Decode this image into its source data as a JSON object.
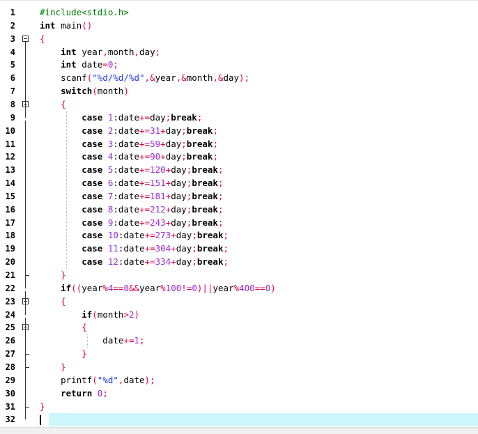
{
  "editor": {
    "lines": [
      {
        "num": "1",
        "code": "#include<stdio.h>"
      },
      {
        "num": "2",
        "code": "int main()"
      },
      {
        "num": "3",
        "code": "{"
      },
      {
        "num": "4",
        "code": "    int year,month,day;"
      },
      {
        "num": "5",
        "code": "    int date=0;"
      },
      {
        "num": "6",
        "code": "    scanf(\"%d/%d/%d\",&year,&month,&day);"
      },
      {
        "num": "7",
        "code": "    switch(month)"
      },
      {
        "num": "8",
        "code": "    {"
      },
      {
        "num": "9",
        "code": "        case 1:date+=day;break;"
      },
      {
        "num": "10",
        "code": "        case 2:date+=31+day;break;"
      },
      {
        "num": "11",
        "code": "        case 3:date+=59+day;break;"
      },
      {
        "num": "12",
        "code": "        case 4:date+=90+day;break;"
      },
      {
        "num": "13",
        "code": "        case 5:date+=120+day;break;"
      },
      {
        "num": "14",
        "code": "        case 6:date+=151+day;break;"
      },
      {
        "num": "15",
        "code": "        case 7:date+=181+day;break;"
      },
      {
        "num": "16",
        "code": "        case 8:date+=212+day;break;"
      },
      {
        "num": "17",
        "code": "        case 9:date+=243+day;break;"
      },
      {
        "num": "18",
        "code": "        case 10:date+=273+day;break;"
      },
      {
        "num": "19",
        "code": "        case 11:date+=304+day;break;"
      },
      {
        "num": "20",
        "code": "        case 12:date+=334+day;break;"
      },
      {
        "num": "21",
        "code": "    }"
      },
      {
        "num": "22",
        "code": "    if((year%4==0&&year%100!=0)||year%400==0)"
      },
      {
        "num": "23",
        "code": "    {"
      },
      {
        "num": "24",
        "code": "        if(month>2)"
      },
      {
        "num": "25",
        "code": "        {"
      },
      {
        "num": "26",
        "code": "            date+=1;"
      },
      {
        "num": "27",
        "code": "        }"
      },
      {
        "num": "28",
        "code": "    }"
      },
      {
        "num": "29",
        "code": "    printf(\"%d\",date);"
      },
      {
        "num": "30",
        "code": "    return 0;"
      },
      {
        "num": "31",
        "code": "}"
      },
      {
        "num": "32",
        "code": ""
      }
    ],
    "current_line": "32",
    "fold_markers": [
      "3",
      "8",
      "23",
      "25"
    ],
    "colors": {
      "keyword": "#000000",
      "preprocessor": "#008000",
      "operator": "#e0004b",
      "number": "#9a2bd6",
      "string": "#1d3be8",
      "current_line_bg": "#cdf6fb"
    }
  }
}
